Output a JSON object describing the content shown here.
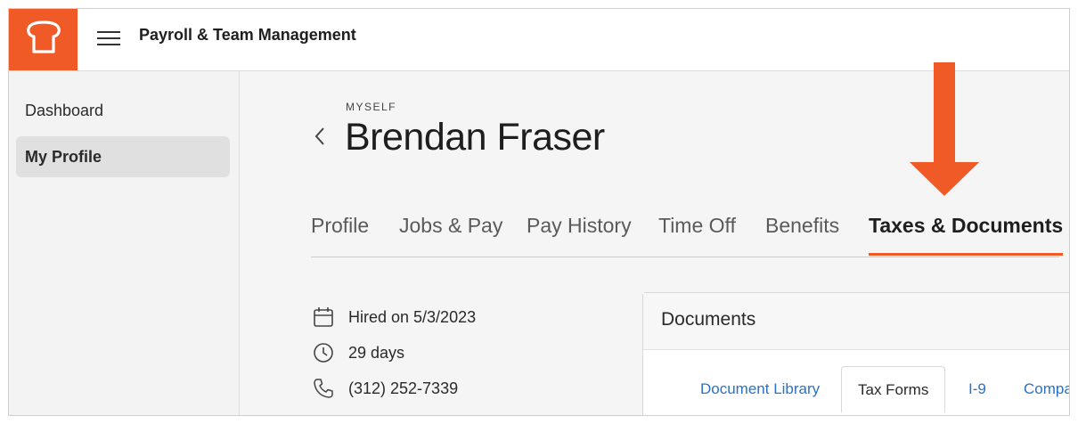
{
  "app": {
    "title": "Payroll & Team Management",
    "brand_color": "#ef5a27"
  },
  "icons": {
    "logo": "toast-logo-icon",
    "menu": "hamburger-menu-icon",
    "back": "chevron-left-icon"
  },
  "sidebar": {
    "items": [
      {
        "label": "Dashboard"
      },
      {
        "label": "My Profile",
        "active": true
      }
    ]
  },
  "profile": {
    "kicker": "MYSELF",
    "name": "Brendan Fraser"
  },
  "tabs": [
    {
      "label": "Profile"
    },
    {
      "label": "Jobs & Pay"
    },
    {
      "label": "Pay History"
    },
    {
      "label": "Time Off"
    },
    {
      "label": "Benefits"
    },
    {
      "label": "Taxes & Documents",
      "active": true
    }
  ],
  "facts": [
    {
      "icon": "calendar-icon",
      "text": "Hired on 5/3/2023"
    },
    {
      "icon": "clock-icon",
      "text": "29 days"
    },
    {
      "icon": "phone-icon",
      "text": "(312) 252-7339"
    }
  ],
  "documents": {
    "title": "Documents",
    "tabs": [
      {
        "label": "Document Library"
      },
      {
        "label": "Tax Forms",
        "selected": true
      },
      {
        "label": "I-9"
      },
      {
        "label": "Compa"
      }
    ]
  }
}
